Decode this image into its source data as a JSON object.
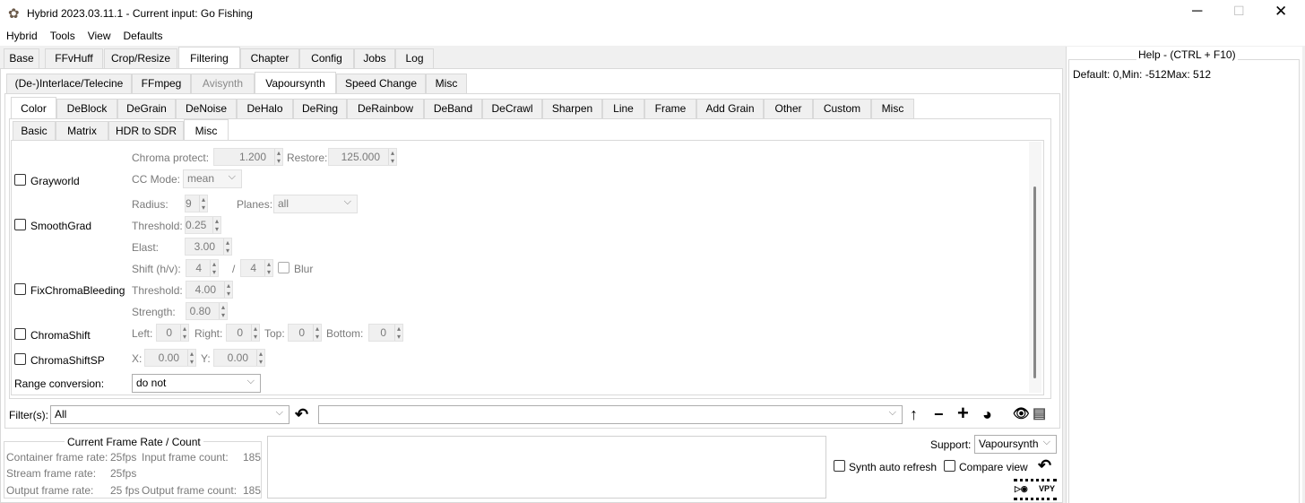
{
  "window": {
    "title": "Hybrid 2023.03.11.1 - Current input: Go Fishing"
  },
  "menu": [
    "Hybrid",
    "Tools",
    "View",
    "Defaults"
  ],
  "main_tabs": [
    "Base",
    "FFvHuff",
    "Crop/Resize",
    "Filtering",
    "Chapter",
    "Config",
    "Jobs",
    "Log"
  ],
  "filter_tabs": [
    "(De-)Interlace/Telecine",
    "FFmpeg",
    "Avisynth",
    "Vapoursynth",
    "Speed Change",
    "Misc"
  ],
  "vs_tabs": [
    "Color",
    "DeBlock",
    "DeGrain",
    "DeNoise",
    "DeHalo",
    "DeRing",
    "DeRainbow",
    "DeBand",
    "DeCrawl",
    "Sharpen",
    "Line",
    "Frame",
    "Add Grain",
    "Other",
    "Custom",
    "Misc"
  ],
  "color_tabs": [
    "Basic",
    "Matrix",
    "HDR to SDR",
    "Misc"
  ],
  "help": {
    "title": "Help - (CTRL + F10)",
    "text": "Default: 0,Min: -512Max: 512"
  },
  "content": {
    "chroma_protect_label": "Chroma protect:",
    "chroma_protect": "1.200",
    "restore_label": "Restore:",
    "restore": "125.000",
    "grayworld": "Grayworld",
    "cc_mode_label": "CC Mode:",
    "cc_mode": "mean",
    "radius_label": "Radius:",
    "radius": "9",
    "planes_label": "Planes:",
    "planes": "all",
    "smoothgrad": "SmoothGrad",
    "sg_threshold_label": "Threshold:",
    "sg_threshold": "0.25",
    "elast_label": "Elast:",
    "elast": "3.00",
    "shift_label": "Shift (h/v):",
    "shift_h": "4",
    "slash": "/",
    "shift_v": "4",
    "blur": "Blur",
    "fixchroma": "FixChromaBleeding",
    "fc_threshold_label": "Threshold:",
    "fc_threshold": "4.00",
    "strength_label": "Strength:",
    "strength": "0.80",
    "chromashift": "ChromaShift",
    "left_label": "Left:",
    "left": "0",
    "right_label": "Right:",
    "right": "0",
    "top_label": "Top:",
    "top": "0",
    "bottom_label": "Bottom:",
    "bottom": "0",
    "chromashiftsp": "ChromaShiftSP",
    "x_label": "X:",
    "x": "0.00",
    "y_label": "Y:",
    "y": "0.00",
    "range_label": "Range conversion:",
    "range": "do not"
  },
  "filters": {
    "label": "Filter(s):",
    "value": "All"
  },
  "frame_rate": {
    "title": "Current Frame Rate / Count",
    "container_label": "Container frame rate:",
    "container": "25fps",
    "input_count_label": "Input frame count:",
    "input_count": "185",
    "stream_label": "Stream frame rate:",
    "stream": "25fps",
    "output_label": "Output frame rate:",
    "output": "25 fps",
    "output_count_label": "Output frame count:",
    "output_count": "185"
  },
  "support": {
    "label": "Support:",
    "value": "Vapoursynth",
    "auto_refresh": "Synth auto refresh",
    "compare": "Compare view",
    "vpy": "VPY"
  }
}
